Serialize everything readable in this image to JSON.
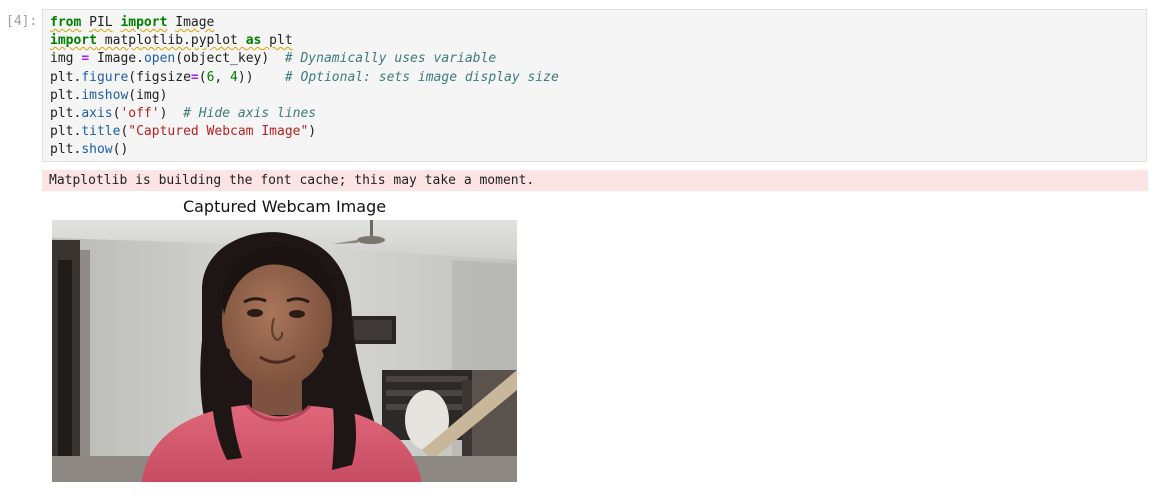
{
  "cell": {
    "prompt": "[4]:",
    "code_lines": [
      [
        {
          "t": "from",
          "c": "kw sq"
        },
        {
          "t": " ",
          "c": ""
        },
        {
          "t": "PIL",
          "c": "sq"
        },
        {
          "t": " ",
          "c": ""
        },
        {
          "t": "import",
          "c": "kw sq"
        },
        {
          "t": " ",
          "c": ""
        },
        {
          "t": "Image",
          "c": "sq"
        }
      ],
      [
        {
          "t": "import",
          "c": "kw sq"
        },
        {
          "t": " matplotlib.pyplot ",
          "c": "sq"
        },
        {
          "t": "as",
          "c": "kw sq"
        },
        {
          "t": " plt",
          "c": "sq"
        }
      ],
      [
        {
          "t": "img ",
          "c": ""
        },
        {
          "t": "=",
          "c": "op"
        },
        {
          "t": " Image.",
          "c": ""
        },
        {
          "t": "open",
          "c": "fn"
        },
        {
          "t": "(object_key)  ",
          "c": ""
        },
        {
          "t": "# Dynamically uses variable",
          "c": "cm"
        }
      ],
      [
        {
          "t": "plt.",
          "c": ""
        },
        {
          "t": "figure",
          "c": "fn"
        },
        {
          "t": "(figsize",
          "c": ""
        },
        {
          "t": "=",
          "c": "op"
        },
        {
          "t": "(",
          "c": ""
        },
        {
          "t": "6",
          "c": "num"
        },
        {
          "t": ", ",
          "c": ""
        },
        {
          "t": "4",
          "c": "num"
        },
        {
          "t": "))    ",
          "c": ""
        },
        {
          "t": "# Optional: sets image display size",
          "c": "cm"
        }
      ],
      [
        {
          "t": "plt.",
          "c": ""
        },
        {
          "t": "imshow",
          "c": "fn"
        },
        {
          "t": "(img)",
          "c": ""
        }
      ],
      [
        {
          "t": "plt.",
          "c": ""
        },
        {
          "t": "axis",
          "c": "fn"
        },
        {
          "t": "(",
          "c": ""
        },
        {
          "t": "'off'",
          "c": "str"
        },
        {
          "t": ")  ",
          "c": ""
        },
        {
          "t": "# Hide axis lines",
          "c": "cm"
        }
      ],
      [
        {
          "t": "plt.",
          "c": ""
        },
        {
          "t": "title",
          "c": "fn"
        },
        {
          "t": "(",
          "c": ""
        },
        {
          "t": "\"Captured Webcam Image\"",
          "c": "str"
        },
        {
          "t": ")",
          "c": ""
        }
      ],
      [
        {
          "t": "plt.",
          "c": ""
        },
        {
          "t": "show",
          "c": "fn"
        },
        {
          "t": "()",
          "c": ""
        }
      ]
    ],
    "stderr": "Matplotlib is building the font cache; this may take a moment.",
    "figure_title": "Captured Webcam Image"
  }
}
